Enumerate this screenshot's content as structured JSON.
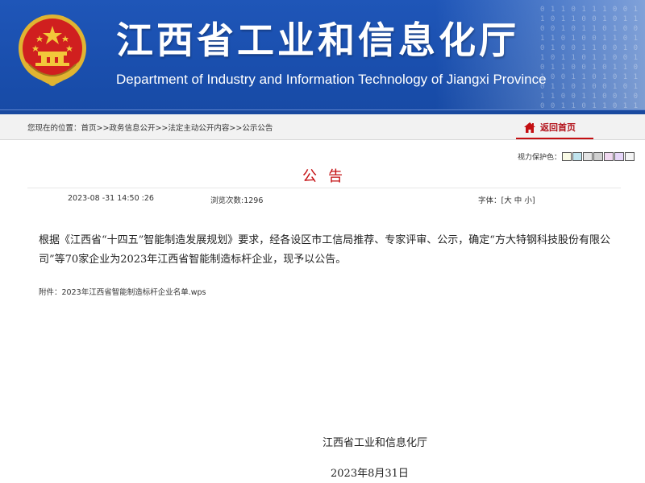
{
  "header": {
    "title_cn": "江西省工业和信息化厅",
    "title_en": "Department of Industry and Information Technology of Jiangxi Province"
  },
  "breadcrumb": {
    "prefix": "您现在的位置：",
    "items": [
      "首页",
      "政务信息公开",
      "法定主动公开内容",
      "公示公告"
    ],
    "separator": ">>",
    "home_link": "返回首页"
  },
  "eyecare": {
    "label": "视力保护色：",
    "colors": [
      "#FAFBE6",
      "#C0E4EE",
      "#E4E4E4",
      "#D0D0D0",
      "#F0D8F0",
      "#E6D6F8",
      "#F4F4F4"
    ]
  },
  "article": {
    "title": "公告",
    "date": "2023-08 -31 14:50 :26",
    "views_label": "浏览次数:",
    "views": "1296",
    "font_label": "字体：[",
    "font_large": "大",
    "font_medium": "中",
    "font_small": "小",
    "font_close": "]",
    "body": "根据《江西省“十四五”智能制造发展规划》要求，经各设区市工信局推荐、专家评审、公示，确定“方大特钢科技股份有限公司”等70家企业为2023年江西省智能制造标杆企业，现予以公告。",
    "attachment_label": "附件：",
    "attachment_name": "2023年江西省智能制造标杆企业名单.wps",
    "signature_org": "江西省工业和信息化厅",
    "signature_date": "2023年8月31日"
  },
  "colors": {
    "banner_blue": "#1a4fae",
    "accent_red": "#c40f12"
  }
}
